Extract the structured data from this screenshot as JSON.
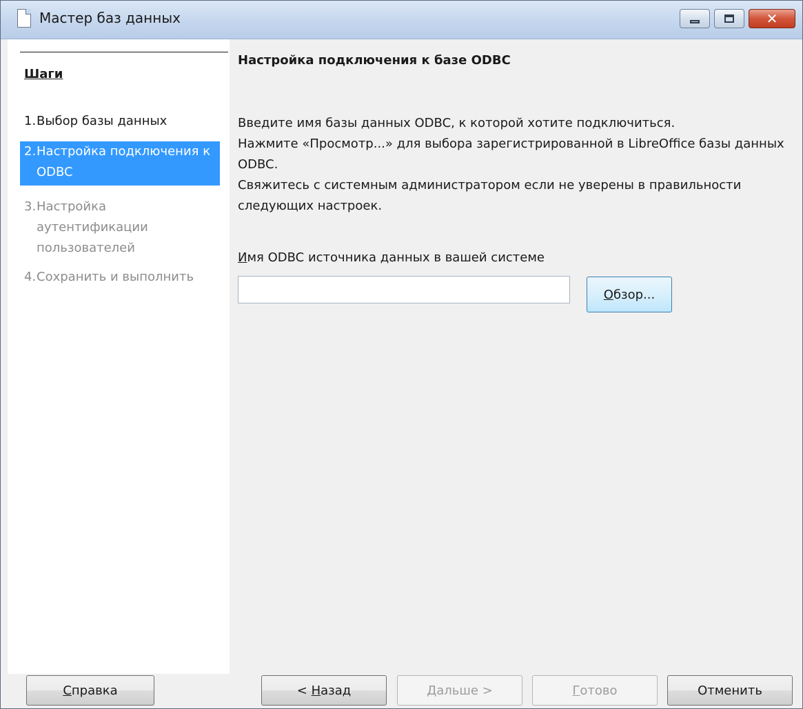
{
  "window": {
    "title": "Мастер баз данных"
  },
  "steps": {
    "title": "Шаги",
    "items": [
      {
        "num": "1.",
        "label": "Выбор базы данных",
        "state": "done"
      },
      {
        "num": "2.",
        "label": "Настройка подключения к ODBC",
        "state": "active"
      },
      {
        "num": "3.",
        "label": "Настройка аутентификации пользователей",
        "state": "disabled"
      },
      {
        "num": "4.",
        "label": "Сохранить и выполнить",
        "state": "disabled"
      }
    ]
  },
  "page": {
    "title": "Настройка подключения к базе ODBC",
    "desc_line1": "Введите имя базы данных ODBC, к которой хотите подключиться.",
    "desc_line2": "Нажмите «Просмотр...» для выбора зарегистрированной в LibreOffice базы данных ODBC.",
    "desc_line3": "Свяжитесь с системным администратором если не уверены в правильности следующих настроек.",
    "field_label_mnemonic": "И",
    "field_label_rest": "мя ODBC источника данных в вашей системе",
    "dsn_value": "",
    "browse_mnemonic": "О",
    "browse_rest": "бзор..."
  },
  "buttons": {
    "help_mnemonic": "С",
    "help_rest": "правка",
    "back_prefix": "< ",
    "back_mnemonic": "Н",
    "back_rest": "азад",
    "next_mnemonic": "Д",
    "next_rest": "альше >",
    "finish_mnemonic": "Г",
    "finish_rest": "отово",
    "cancel": "Отменить"
  },
  "colors": {
    "selection": "#3399ff",
    "disabled_text": "#8c8c8c"
  }
}
